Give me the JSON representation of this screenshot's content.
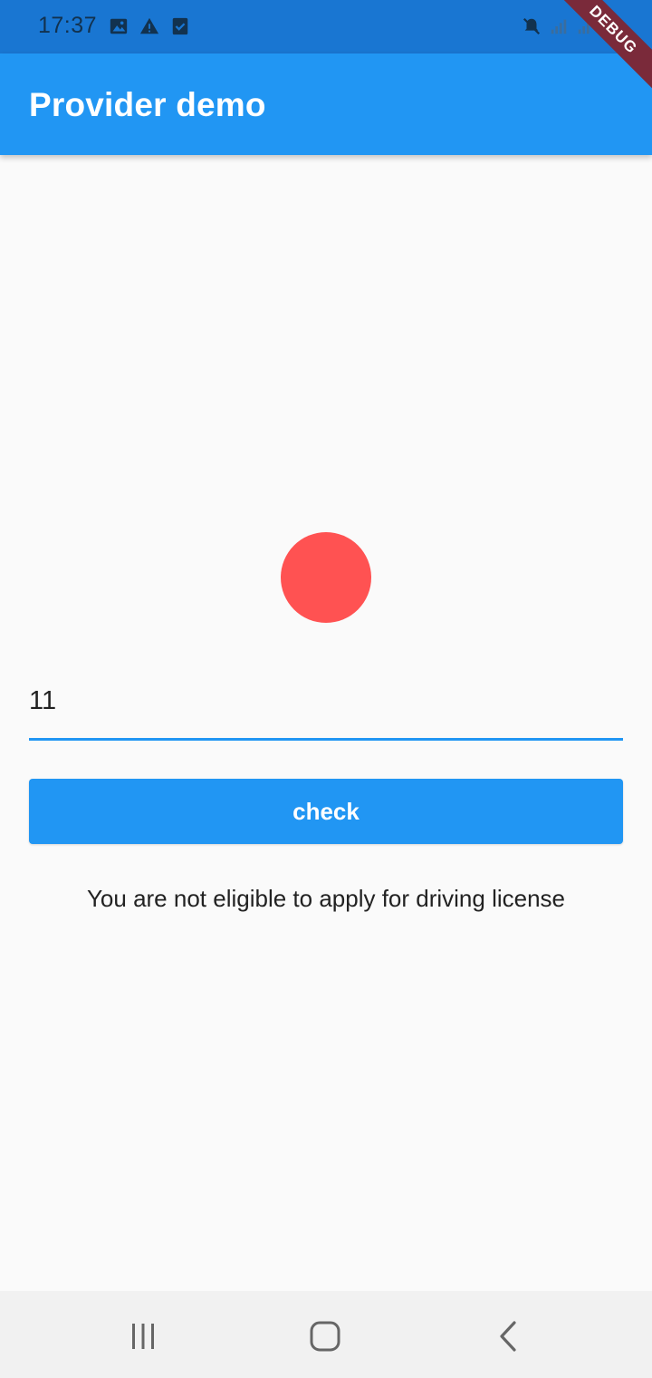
{
  "status_bar": {
    "time": "17:37",
    "icons_left": [
      "image-icon",
      "warning-icon",
      "check-box-icon"
    ],
    "icons_right": [
      "mute-icon",
      "signal-icon",
      "signal-icon",
      "battery-icon"
    ]
  },
  "debug_banner": {
    "label": "DEBUG"
  },
  "app_bar": {
    "title": "Provider demo"
  },
  "indicator": {
    "color": "#ff5252"
  },
  "age_input": {
    "value": "11"
  },
  "check_button": {
    "label": "check"
  },
  "result": {
    "text": "You are not eligible to apply for driving license"
  },
  "nav_bar": {
    "icons": [
      "recent-apps-icon",
      "home-icon",
      "back-icon"
    ]
  },
  "colors": {
    "primary": "#2196f3",
    "status_bar": "#1976d2",
    "background": "#fafafa"
  }
}
